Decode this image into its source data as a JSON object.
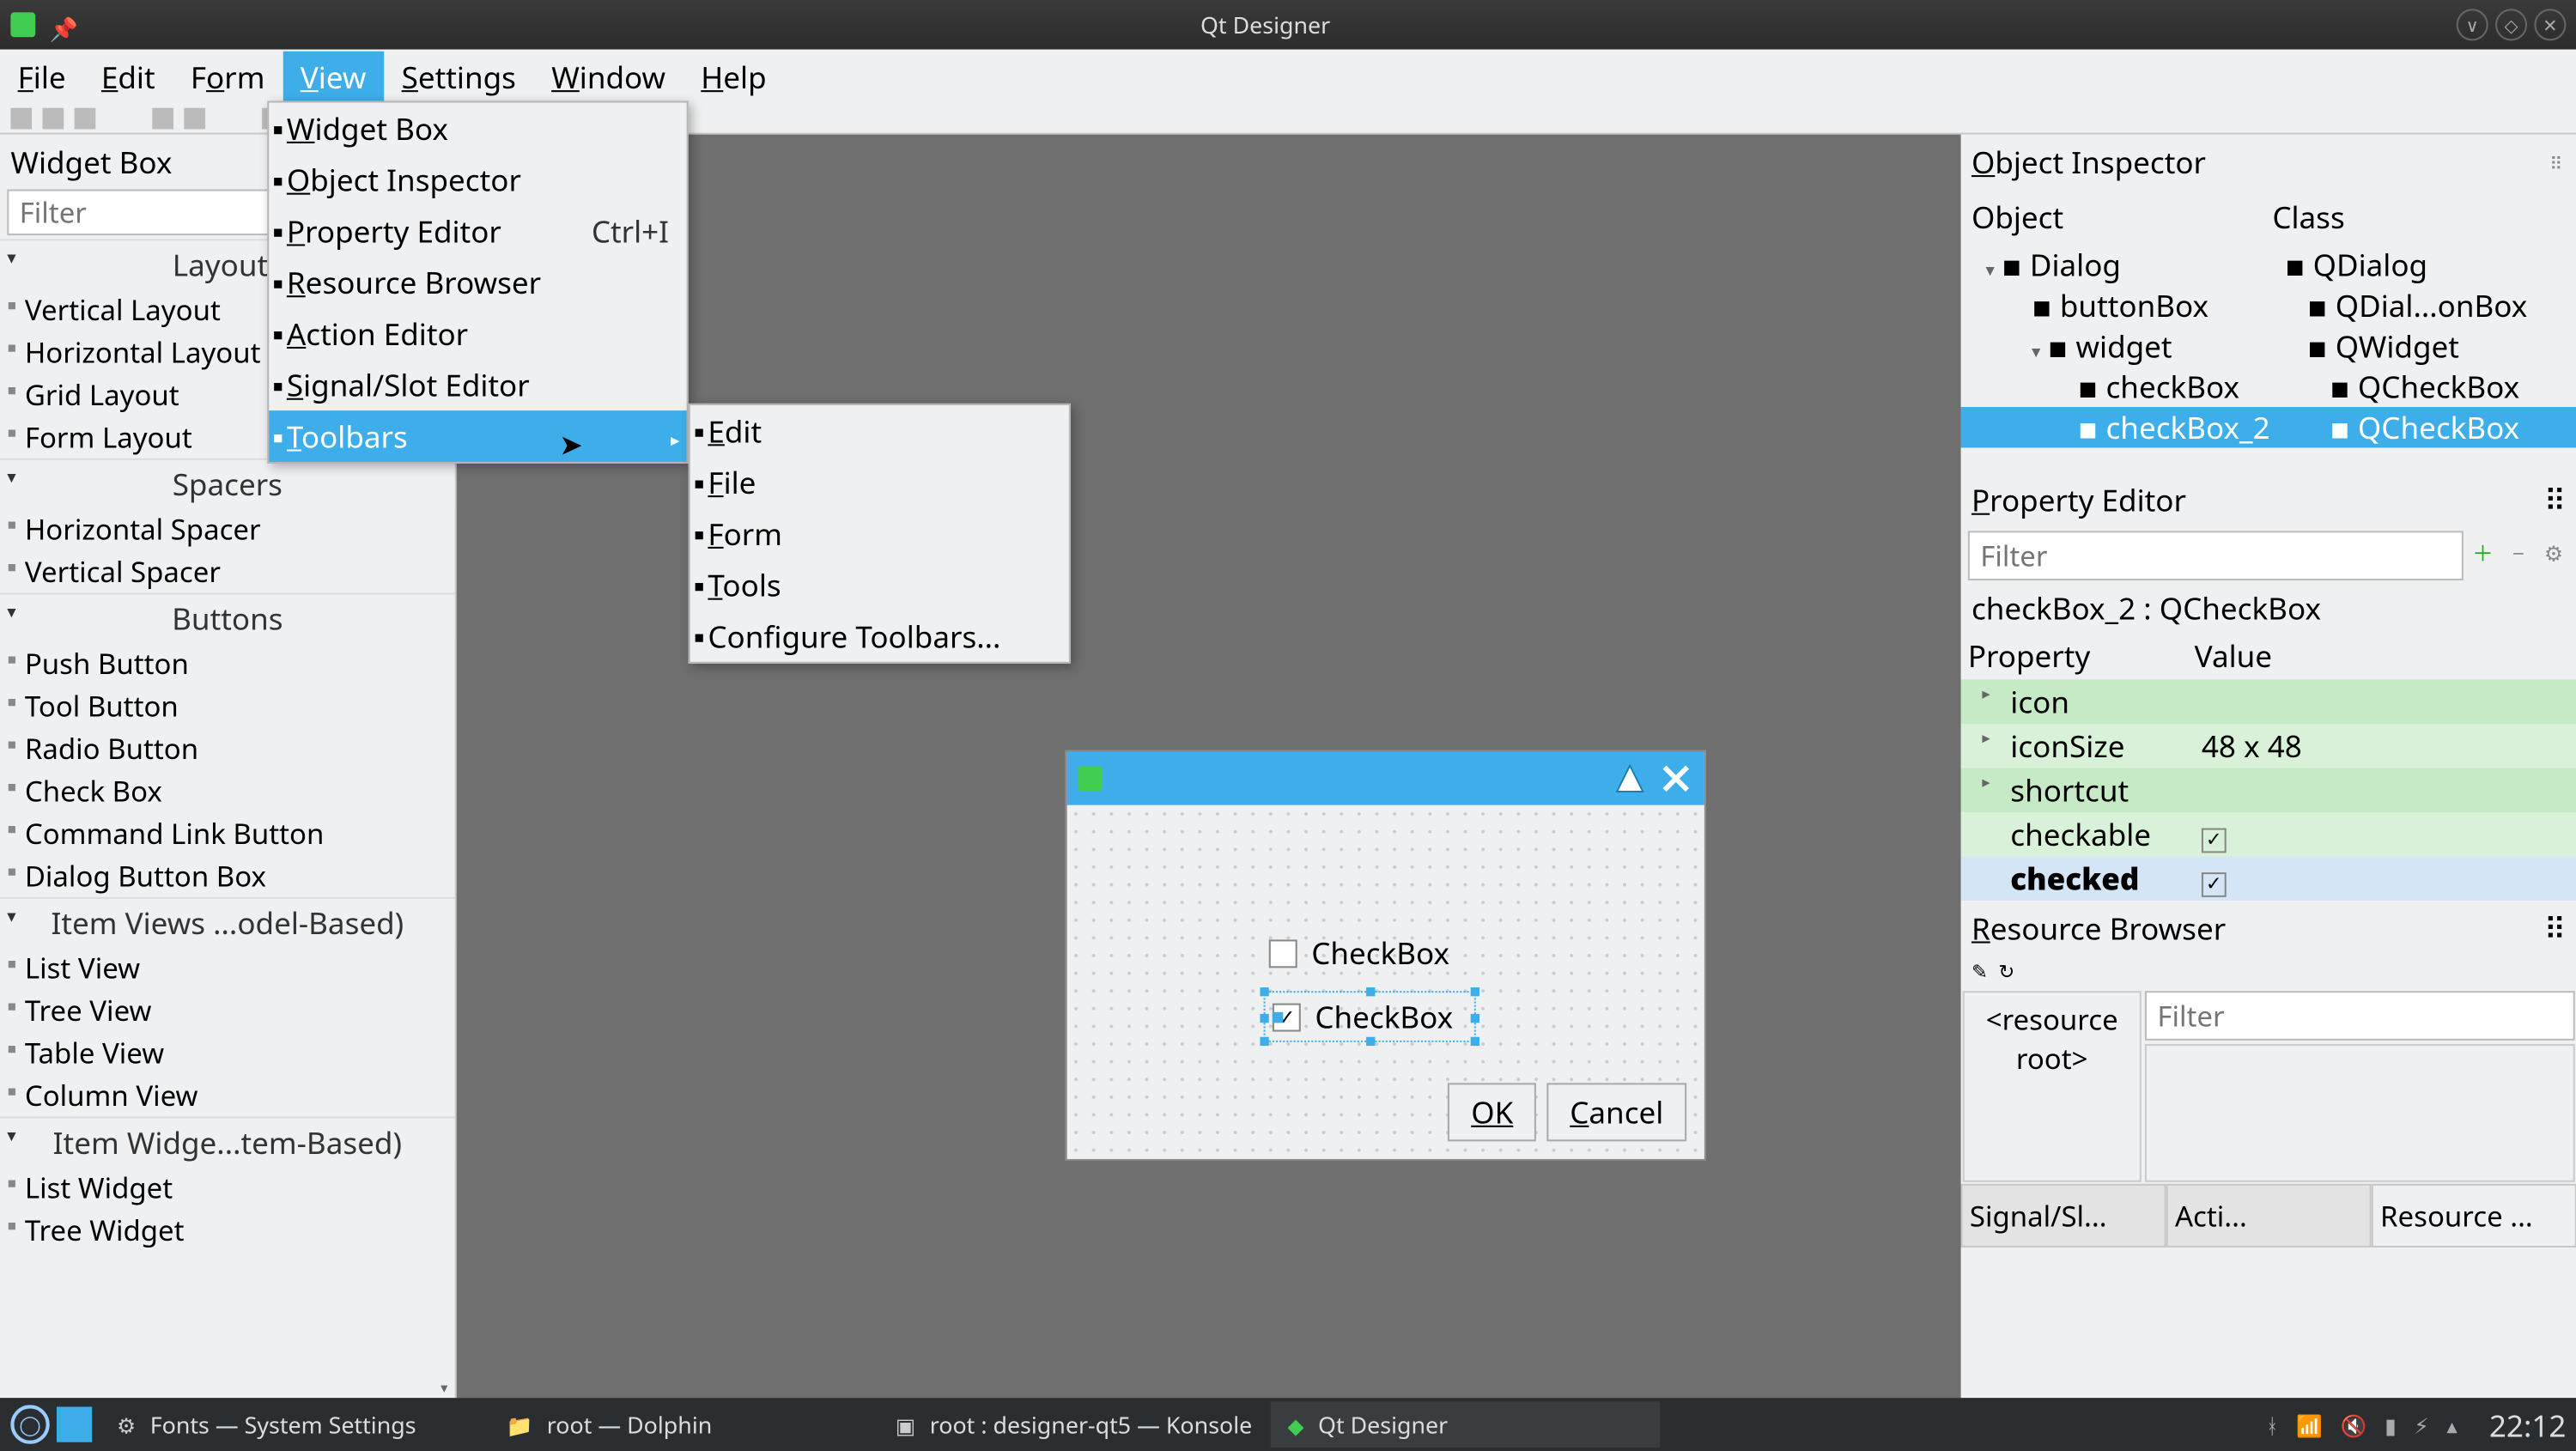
{
  "window": {
    "title": "Qt Designer"
  },
  "menubar": [
    "File",
    "Edit",
    "Form",
    "View",
    "Settings",
    "Window",
    "Help"
  ],
  "menubar_selected": "View",
  "view_menu": {
    "items": [
      {
        "label": "Widget Box",
        "shortcut": ""
      },
      {
        "label": "Object Inspector",
        "shortcut": ""
      },
      {
        "label": "Property Editor",
        "shortcut": "Ctrl+I"
      },
      {
        "label": "Resource Browser",
        "shortcut": ""
      },
      {
        "label": "Action Editor",
        "shortcut": ""
      },
      {
        "label": "Signal/Slot Editor",
        "shortcut": ""
      },
      {
        "label": "Toolbars",
        "shortcut": "",
        "submenu": true,
        "selected": true
      }
    ],
    "toolbars_submenu": [
      "Edit",
      "File",
      "Form",
      "Tools",
      "Configure Toolbars..."
    ]
  },
  "widget_box": {
    "title": "Widget Box",
    "filter_placeholder": "Filter",
    "groups": [
      {
        "name": "Layouts",
        "items": [
          "Vertical Layout",
          "Horizontal Layout",
          "Grid Layout",
          "Form Layout"
        ]
      },
      {
        "name": "Spacers",
        "items": [
          "Horizontal Spacer",
          "Vertical Spacer"
        ]
      },
      {
        "name": "Buttons",
        "items": [
          "Push Button",
          "Tool Button",
          "Radio Button",
          "Check Box",
          "Command Link Button",
          "Dialog Button Box"
        ]
      },
      {
        "name": "Item Views ...odel-Based)",
        "items": [
          "List View",
          "Tree View",
          "Table View",
          "Column View"
        ]
      },
      {
        "name": "Item Widge...tem-Based)",
        "items": [
          "List Widget",
          "Tree Widget"
        ]
      }
    ]
  },
  "object_inspector": {
    "title": "Object Inspector",
    "col_object": "Object",
    "col_class": "Class",
    "rows": [
      {
        "obj": "Dialog",
        "cls": "QDialog",
        "indent": 0,
        "expand": true
      },
      {
        "obj": "buttonBox",
        "cls": "QDial...onBox",
        "indent": 1
      },
      {
        "obj": "widget",
        "cls": "QWidget",
        "indent": 1,
        "expand": true
      },
      {
        "obj": "checkBox",
        "cls": "QCheckBox",
        "indent": 2
      },
      {
        "obj": "checkBox_2",
        "cls": "QCheckBox",
        "indent": 2,
        "selected": true
      }
    ]
  },
  "property_editor": {
    "title": "Property Editor",
    "filter_placeholder": "Filter",
    "object_label": "checkBox_2 : QCheckBox",
    "col_property": "Property",
    "col_value": "Value",
    "rows": [
      {
        "name": "icon",
        "value": "",
        "cls": "g1",
        "caret": true
      },
      {
        "name": "iconSize",
        "value": "48 x 48",
        "cls": "g2",
        "caret": true
      },
      {
        "name": "shortcut",
        "value": "",
        "cls": "g1",
        "caret": true
      },
      {
        "name": "checkable",
        "value": "✓",
        "cls": "g2"
      },
      {
        "name": "checked",
        "value": "✓",
        "cls": "sel",
        "bold": true
      }
    ]
  },
  "resource_browser": {
    "title": "Resource Browser",
    "filter_placeholder": "Filter",
    "root_label": "<resource root>",
    "tabs": [
      "Signal/Sl...",
      "Acti...",
      "Resource ..."
    ],
    "active_tab": 2
  },
  "dialog": {
    "checkbox1_label": "CheckBox",
    "checkbox2_label": "CheckBox",
    "ok": "OK",
    "cancel": "Cancel"
  },
  "taskbar": {
    "tasks": [
      {
        "icon": "settings",
        "label": "Fonts  — System Settings"
      },
      {
        "icon": "folder",
        "label": "root — Dolphin"
      },
      {
        "icon": "terminal",
        "label": "root : designer-qt5 — Konsole"
      },
      {
        "icon": "qt",
        "label": "Qt Designer",
        "active": true
      }
    ],
    "clock": "22:12"
  }
}
